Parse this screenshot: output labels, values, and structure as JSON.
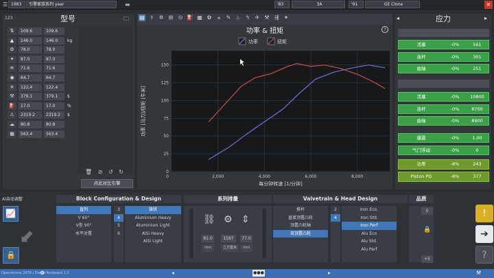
{
  "topbar": {
    "year": "1983",
    "family": "引擎家族系列 year",
    "code1": "'83",
    "variant1": "3A",
    "code2": "'91",
    "variant2": "GE Clone"
  },
  "left": {
    "title": "型号",
    "count": "123",
    "compare_button": "点此对比引擎",
    "rows": [
      {
        "icon": "⇅",
        "v1": "109.6",
        "v2": "109.6",
        "unit": ""
      },
      {
        "icon": "▲",
        "v1": "146.0",
        "v2": "146.0",
        "unit": "kg"
      },
      {
        "icon": "⚙",
        "v1": "78.0",
        "v2": "78.0",
        "unit": ""
      },
      {
        "icon": "✦",
        "v1": "87.0",
        "v2": "87.0",
        "unit": ""
      },
      {
        "icon": "≋",
        "v1": "71.6",
        "v2": "71.6",
        "unit": ""
      },
      {
        "icon": "◉",
        "v1": "64.7",
        "v2": "64.7",
        "unit": ""
      },
      {
        "icon": "✳",
        "v1": "122.4",
        "v2": "122.4",
        "unit": ""
      },
      {
        "icon": "⚒",
        "v1": "379.1",
        "v2": "379.1",
        "unit": "$"
      },
      {
        "icon": "⛽",
        "v1": "17.0",
        "v2": "17.0",
        "unit": "%"
      },
      {
        "icon": "⚠",
        "v1": "2319.2",
        "v2": "2319.2",
        "unit": "$"
      },
      {
        "icon": "☁",
        "v1": "80.8",
        "v2": "80.8",
        "unit": ""
      },
      {
        "icon": "▦",
        "v1": "563.4",
        "v2": "563.4",
        "unit": ""
      }
    ]
  },
  "right": {
    "title": "应力",
    "g1": [
      {
        "label": "活塞",
        "pct": "-0%",
        "val": "561"
      },
      {
        "label": "连杆",
        "pct": "-0%",
        "val": "301"
      },
      {
        "label": "曲轴",
        "pct": "-0%",
        "val": "251"
      }
    ],
    "g2": [
      {
        "label": "活塞",
        "pct": "-0%",
        "val": "10800"
      },
      {
        "label": "连杆",
        "pct": "-0%",
        "val": "8700"
      },
      {
        "label": "曲轴",
        "pct": "-0%",
        "val": "8900"
      }
    ],
    "g3": [
      {
        "label": "爆震",
        "pct": "-0%",
        "val": "1.00"
      },
      {
        "label": "气门浮动",
        "pct": "-0%",
        "val": "0"
      }
    ],
    "g4": [
      {
        "label": "功率",
        "pct": "-8%",
        "val": "243"
      },
      {
        "label": "Piston PD",
        "pct": "-6%",
        "val": "377"
      }
    ]
  },
  "chart_data": {
    "type": "line",
    "title": "功率 & 扭矩",
    "xlabel": "每分钟转速 [1/分钟]",
    "ylabel": "功率 [马力]/扭矩 [牛米]",
    "xlim": [
      0,
      9400
    ],
    "ylim": [
      0,
      170
    ],
    "xticks": [
      2000,
      4000,
      6000,
      8000
    ],
    "yticks": [
      0,
      25,
      50,
      75,
      100,
      125,
      150
    ],
    "legend": "top-center",
    "series": [
      {
        "name": "功率",
        "color": "#7a6fe0",
        "points": [
          [
            1600,
            17
          ],
          [
            2500,
            35
          ],
          [
            3200,
            52
          ],
          [
            4000,
            70
          ],
          [
            4800,
            88
          ],
          [
            5500,
            110
          ],
          [
            6200,
            130
          ],
          [
            7000,
            140
          ],
          [
            7800,
            146
          ],
          [
            8500,
            150
          ],
          [
            9200,
            146
          ]
        ]
      },
      {
        "name": "扭矩",
        "color": "#d24a55",
        "points": [
          [
            1600,
            70
          ],
          [
            2300,
            95
          ],
          [
            3000,
            120
          ],
          [
            3600,
            132
          ],
          [
            4300,
            138
          ],
          [
            5000,
            148
          ],
          [
            5400,
            152
          ],
          [
            6000,
            148
          ],
          [
            6600,
            150
          ],
          [
            7300,
            145
          ],
          [
            8000,
            137
          ],
          [
            8600,
            128
          ],
          [
            9200,
            117
          ]
        ]
      }
    ]
  },
  "bottom": {
    "auto": "AI自动调整",
    "block": {
      "title": "Block Configuration & Design",
      "layouts": [
        "直列",
        "V 60°",
        "V型 90°",
        "水平对置"
      ],
      "cyl_counts": [
        "3",
        "4",
        "5",
        "6"
      ],
      "materials": [
        "铸铁",
        "Aluminium Heavy",
        "Aluminium Light",
        "AlSi Heavy",
        "AlSi Light"
      ]
    },
    "disp": {
      "title": "系列排量",
      "vals": [
        "81.0",
        "1587",
        "77.0"
      ],
      "units": [
        "mm",
        "立方厘米",
        "mm"
      ]
    },
    "valve": {
      "title": "Valvetrain & Head Design",
      "types": [
        "推杆",
        "直接顶置凸轮",
        "顶置凸轮轴",
        "双顶置凸轮"
      ],
      "valves": [
        "2",
        "4"
      ],
      "head": [
        "Iron Eco.",
        "Iron Std.",
        "Iron Perf",
        "Alu Eco",
        "Alu Std.",
        "Alu Perf"
      ]
    },
    "quality": {
      "title": "品质",
      "top": "0",
      "bottom": "+5"
    },
    "footer": "OpenAmmo 2078 / Diesel Keyboard 1.0"
  }
}
